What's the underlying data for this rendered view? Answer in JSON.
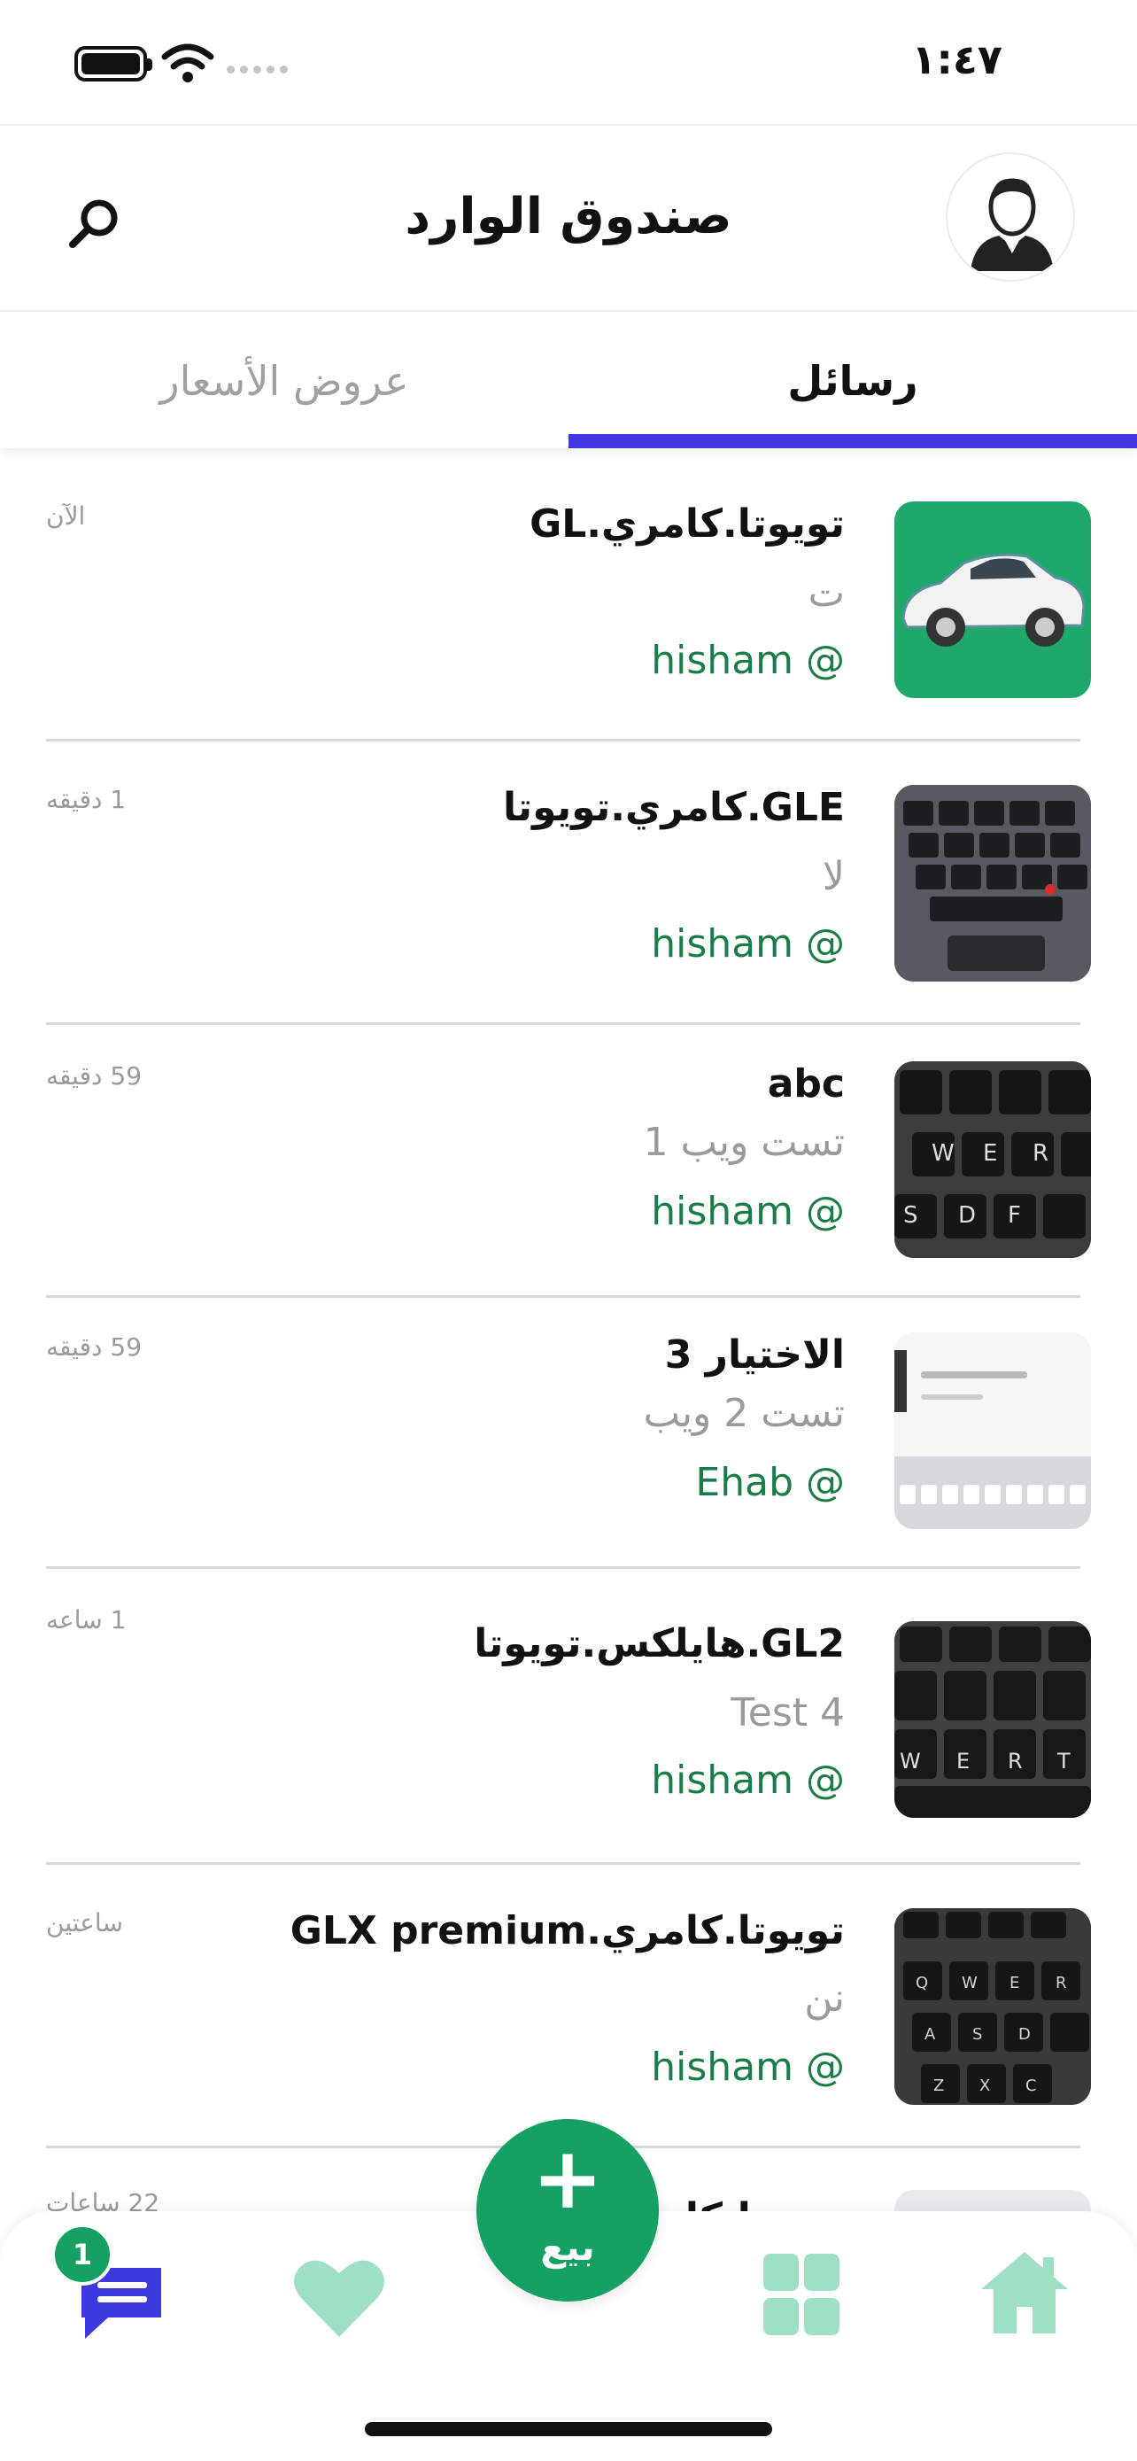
{
  "status_bar": {
    "time": "١:٤٧"
  },
  "header": {
    "title": "صندوق الوارد"
  },
  "tabs": [
    {
      "label": "رسائل",
      "active": true
    },
    {
      "label": "عروض الأسعار",
      "active": false
    }
  ],
  "conversations": [
    {
      "title": "تويوتا.كامري.GL",
      "preview": "ت",
      "sender": "hisham @",
      "time": "الآن",
      "thumb": "car"
    },
    {
      "title": "GLE.كامري.تويوتا",
      "preview": "لا",
      "sender": "hisham @",
      "time": "1 دقيقه",
      "thumb": "keyboard-1"
    },
    {
      "title": "abc",
      "preview": "تست ويب 1",
      "sender": "hisham @",
      "time": "59 دقيقه",
      "thumb": "keyboard-2"
    },
    {
      "title": "الاختيار 3",
      "preview": "تست 2 ويب",
      "sender": "Ehab @",
      "time": "59 دقيقه",
      "thumb": "screenshot"
    },
    {
      "title": "GL2.هايلكس.تويوتا",
      "preview": "Test 4",
      "sender": "hisham @",
      "time": "1 ساعه",
      "thumb": "keyboard-3"
    },
    {
      "title": "تويوتا.كامري.GLX premium",
      "preview": "نن",
      "sender": "hisham @",
      "time": "ساعتين",
      "thumb": "keyboard-4"
    },
    {
      "title": "تويوتا.كامري",
      "preview": "",
      "sender": "",
      "time": "22 ساعات",
      "thumb": "light"
    }
  ],
  "bottom_nav": {
    "messages_badge": "1",
    "sell_label": "بيع",
    "items": [
      "messages-icon",
      "heart-icon",
      "sell-button",
      "grid-icon",
      "home-icon"
    ]
  },
  "colors": {
    "accent": "#4437e0",
    "brand_green": "#15a162",
    "sender_green": "#1a7d48",
    "nav_icon_light": "#9fe0c4"
  }
}
